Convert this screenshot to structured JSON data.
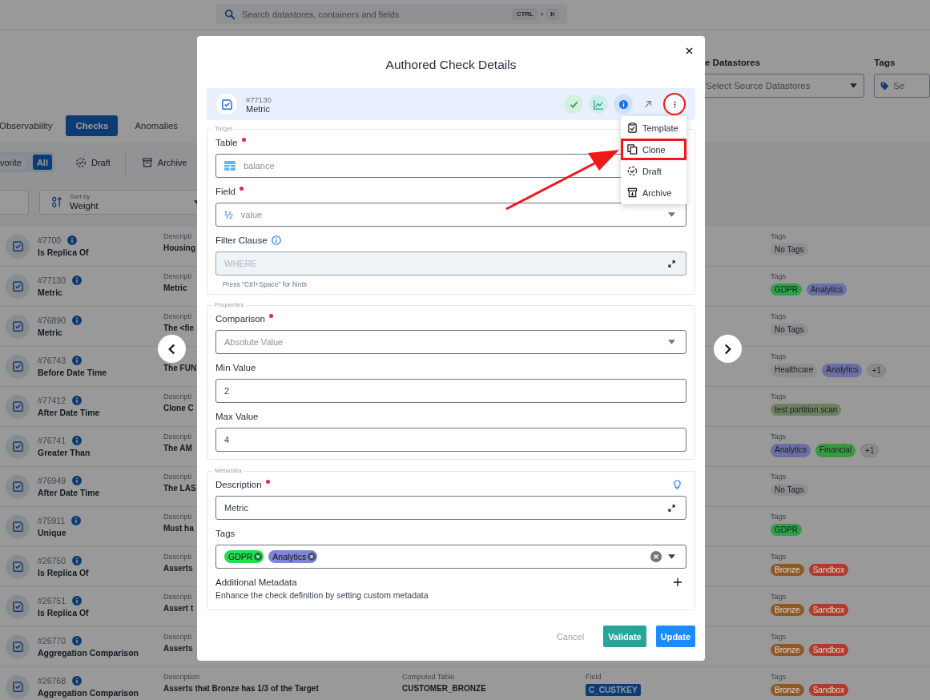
{
  "search": {
    "placeholder": "Search datastores, containers and fields",
    "shortcut": [
      {
        "text": "CTRL",
        "kind": "key"
      },
      {
        "text": "+",
        "kind": "plus"
      },
      {
        "text": "K",
        "kind": "key"
      }
    ]
  },
  "filters": [
    {
      "label": "e Datastores",
      "placeholder": "Select Source Datastores",
      "kind": "select"
    },
    {
      "label": "Tags",
      "placeholder": "Se",
      "kind": "tags"
    }
  ],
  "tabs": [
    {
      "label": "Observability",
      "selected": false
    },
    {
      "label": "Checks",
      "selected": true
    },
    {
      "label": "Anomalies",
      "selected": false
    }
  ],
  "status_filters": {
    "segments": [
      {
        "label": "vorite",
        "selected": false
      },
      {
        "label": "All",
        "selected": true
      }
    ],
    "items": [
      {
        "label": "Draft",
        "kind": "draft"
      },
      {
        "label": "Archive",
        "kind": "archive"
      }
    ]
  },
  "sort": {
    "label": "Sort by",
    "value": "Weight"
  },
  "rows": [
    {
      "id": "#7700",
      "name": "Is Replica Of",
      "description_label": "Descripti",
      "description": "Housing",
      "tags_label": "Tags",
      "tags": [
        {
          "label": "No Tags",
          "color": "#8c8e91"
        }
      ]
    },
    {
      "id": "#77130",
      "name": "Metric",
      "description_label": "Descripti",
      "description": "Metric",
      "tags_label": "Tags",
      "tags": [
        {
          "label": "GDPR",
          "color": "#2f9e4a"
        },
        {
          "label": "Analytics",
          "color": "#6b6fa3"
        }
      ]
    },
    {
      "id": "#76890",
      "name": "Metric",
      "description_label": "Descripti",
      "description": "The <fie",
      "tags_label": "Tags",
      "tags": [
        {
          "label": "No Tags",
          "color": "#8c8e91"
        }
      ]
    },
    {
      "id": "#76743",
      "name": "Before Date Time",
      "description": "The FUN",
      "tags_label": "Tags",
      "tags": [
        {
          "label": "Healthcare",
          "color": "#8c8e91"
        },
        {
          "label": "Analytics",
          "color": "#6b6fa3"
        }
      ],
      "more": "+1"
    },
    {
      "id": "#77412",
      "name": "After Date Time",
      "description_label": "Descripti",
      "description": "Clone C",
      "tags_label": "Tags",
      "tags": [
        {
          "label": "test partition scan",
          "color": "#6c8062"
        }
      ]
    },
    {
      "id": "#76741",
      "name": "Greater Than",
      "description_label": "Descripti",
      "description": "The AM",
      "tags_label": "Tags",
      "tags": [
        {
          "label": "Analytics",
          "color": "#6b6fa3"
        },
        {
          "label": "Financial",
          "color": "#3a9a42"
        }
      ],
      "more": "+1"
    },
    {
      "id": "#76949",
      "name": "After Date Time",
      "description_label": "Descripti",
      "description": "The LAS",
      "tags_label": "Tags",
      "tags": [
        {
          "label": "No Tags",
          "color": "#8c8e91"
        }
      ]
    },
    {
      "id": "#75911",
      "name": "Unique",
      "description_label": "Descripti",
      "description": "Must ha",
      "tags_label": "Tags",
      "tags": [
        {
          "label": "GDPR",
          "color": "#2f9e4a"
        }
      ]
    },
    {
      "id": "#26750",
      "name": "Is Replica Of",
      "description_label": "Descripti",
      "description": "Asserts",
      "tags_label": "Tags",
      "tags": [
        {
          "label": "Bronze",
          "color": "#8b5a2b"
        },
        {
          "label": "Sandbox",
          "color": "#b03a2e"
        }
      ]
    },
    {
      "id": "#26751",
      "name": "Is Replica Of",
      "description_label": "Descripti",
      "description": "Assert t",
      "tags_label": "Tags",
      "tags": [
        {
          "label": "Bronze",
          "color": "#8b5a2b"
        },
        {
          "label": "Sandbox",
          "color": "#b03a2e"
        }
      ]
    },
    {
      "id": "#26770",
      "name": "Aggregation Comparison",
      "description_label": "Descripti",
      "description": "Asserts",
      "tags_label": "Tags",
      "tags": [
        {
          "label": "Bronze",
          "color": "#8b5a2b"
        },
        {
          "label": "Sandbox",
          "color": "#b03a2e"
        }
      ]
    },
    {
      "id": "#26768",
      "name": "Aggregation Comparison",
      "description_label": "Description",
      "description": "Asserts that Bronze has 1/3 of the Target",
      "computed_label": "Computed Table",
      "computed": "CUSTOMER_BRONZE",
      "field_label": "Field",
      "field": "C_CUSTKEY",
      "tags_label": "Tags",
      "tags": [
        {
          "label": "Bronze",
          "color": "#8b5a2b"
        },
        {
          "label": "Sandbox",
          "color": "#b03a2e"
        }
      ]
    }
  ],
  "modal": {
    "title": "Authored Check Details",
    "check": {
      "id": "#77130",
      "name": "Metric"
    },
    "actions": [
      {
        "kind": "passed"
      },
      {
        "kind": "chart"
      },
      {
        "kind": "info"
      },
      {
        "kind": "open"
      },
      {
        "kind": "more",
        "highlighted": true
      }
    ],
    "menu": [
      {
        "label": "Template",
        "kind": "template",
        "highlighted": false
      },
      {
        "label": "Clone",
        "kind": "clone",
        "highlighted": true
      },
      {
        "label": "Draft",
        "kind": "draft",
        "highlighted": false
      },
      {
        "label": "Archive",
        "kind": "archive",
        "highlighted": false
      }
    ],
    "sections": [
      {
        "legend": "Target",
        "fields": [
          {
            "label": "Table",
            "required": true,
            "kind": "table",
            "value": "balance",
            "disabled": true
          },
          {
            "label": "Field",
            "required": true,
            "kind": "field",
            "glyph": "½",
            "value": "value",
            "disabled": true
          },
          {
            "label": "Filter Clause",
            "required": false,
            "kind": "filter",
            "placeholder": "WHERE",
            "hint": "Press \"Ctrl+Space\" for hints"
          }
        ]
      },
      {
        "legend": "Properties",
        "fields": [
          {
            "label": "Comparison",
            "required": true,
            "kind": "select",
            "value": "Absolute Value",
            "disabled": true
          },
          {
            "label": "Min Value",
            "required": false,
            "kind": "input",
            "value": "2",
            "disabled": false
          },
          {
            "label": "Max Value",
            "required": false,
            "kind": "input",
            "value": "4",
            "disabled": false
          }
        ]
      },
      {
        "legend": "Metadata",
        "fields": [
          {
            "label": "Description",
            "required": true,
            "kind": "description",
            "value": "Metric",
            "disabled": false
          },
          {
            "label": "Tags",
            "required": false,
            "kind": "tags",
            "tags": [
              {
                "label": "GDPR",
                "color": "#22e052"
              },
              {
                "label": "Analytics",
                "color": "#7f86d4"
              }
            ]
          },
          {
            "label": "Additional Metadata",
            "kind": "additional",
            "text": "Enhance the check definition by setting custom metadata"
          }
        ]
      }
    ],
    "footer": [
      {
        "label": "Cancel",
        "kind": "text"
      },
      {
        "label": "Validate",
        "kind": "validate"
      },
      {
        "label": "Update",
        "kind": "primary"
      }
    ]
  }
}
